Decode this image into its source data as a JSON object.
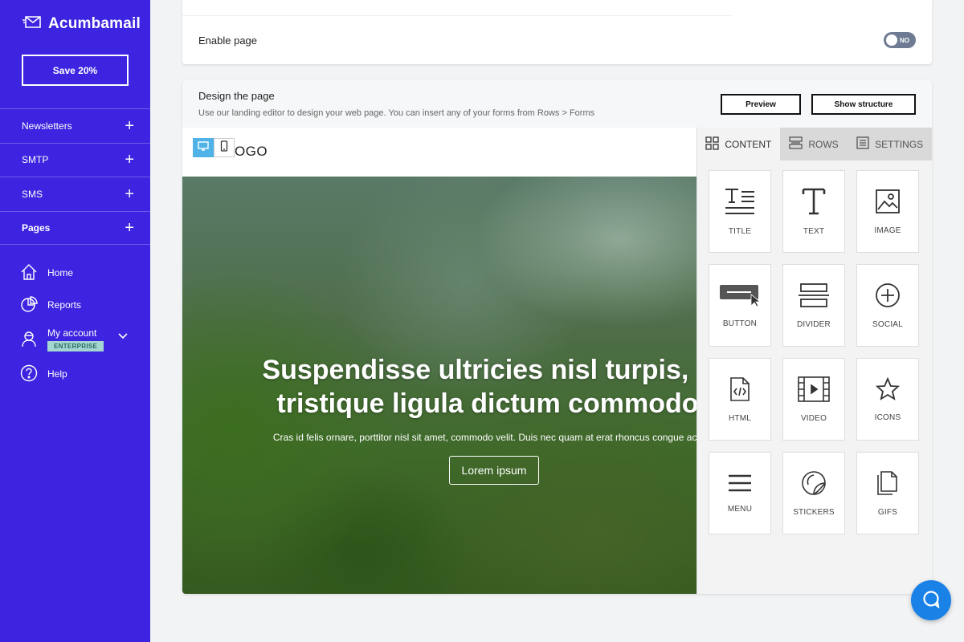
{
  "brand": {
    "name": "Acumbamail"
  },
  "sidebar": {
    "save_label": "Save 20%",
    "sections": [
      {
        "label": "Newsletters",
        "icon": "plus-icon"
      },
      {
        "label": "SMTP",
        "icon": "plus-icon"
      },
      {
        "label": "SMS",
        "icon": "plus-icon"
      },
      {
        "label": "Pages",
        "icon": "plus-icon"
      }
    ],
    "links": [
      {
        "label": "Home",
        "icon": "home-icon"
      },
      {
        "label": "Reports",
        "icon": "pie-chart-icon"
      },
      {
        "label": "My account",
        "icon": "user-icon",
        "badge": "ENTERPRISE"
      },
      {
        "label": "Help",
        "icon": "help-icon"
      }
    ]
  },
  "enable_page": {
    "label": "Enable page",
    "toggle_label": "NO",
    "on": false
  },
  "design": {
    "title": "Design the page",
    "subtitle": "Use our landing editor to design your web page. You can insert any of your forms from Rows > Forms",
    "preview_label": "Preview",
    "structure_label": "Show structure"
  },
  "canvas": {
    "logo_text": "LOGO",
    "hero_title_line1": "Suspendisse ultricies nisl turpis, n",
    "hero_title_line2": "tristique ligula dictum commodo",
    "hero_text": "Cras id felis ornare, porttitor nisl sit amet, commodo velit. Duis nec quam at erat rhoncus congue ac ut m",
    "hero_button": "Lorem ipsum"
  },
  "panel": {
    "tabs": [
      {
        "label": "CONTENT",
        "icon": "grid-icon",
        "active": true
      },
      {
        "label": "ROWS",
        "icon": "rows-icon",
        "active": false
      },
      {
        "label": "SETTINGS",
        "icon": "settings-icon",
        "active": false
      }
    ],
    "tiles": [
      {
        "label": "TITLE",
        "icon": "title-icon"
      },
      {
        "label": "TEXT",
        "icon": "text-icon"
      },
      {
        "label": "IMAGE",
        "icon": "image-icon"
      },
      {
        "label": "BUTTON",
        "icon": "button-icon"
      },
      {
        "label": "DIVIDER",
        "icon": "divider-icon"
      },
      {
        "label": "SOCIAL",
        "icon": "social-icon"
      },
      {
        "label": "HTML",
        "icon": "html-icon"
      },
      {
        "label": "VIDEO",
        "icon": "video-icon"
      },
      {
        "label": "ICONS",
        "icon": "star-icon"
      },
      {
        "label": "MENU",
        "icon": "menu-icon"
      },
      {
        "label": "STICKERS",
        "icon": "sticker-icon"
      },
      {
        "label": "GIFS",
        "icon": "gif-icon"
      }
    ]
  },
  "colors": {
    "sidebar": "#3d24e0",
    "device_active": "#4fb3e8",
    "toggle_off": "#6e7b92",
    "chat": "#1a82e6",
    "badge_bg": "#a5d7d1"
  }
}
